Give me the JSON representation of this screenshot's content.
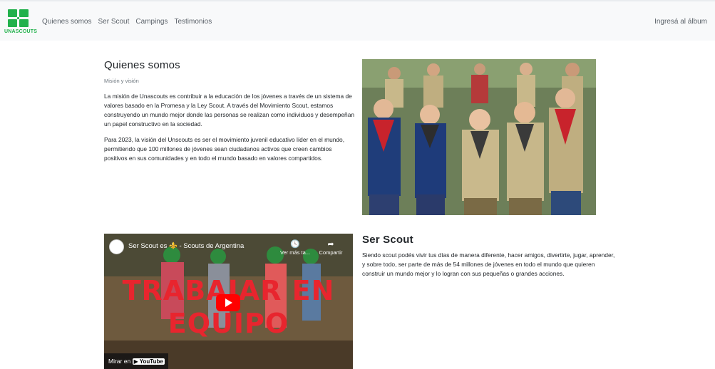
{
  "brand": {
    "name": "UNASCOUTS",
    "color": "#22b14c"
  },
  "nav": {
    "links": [
      "Quienes somos",
      "Ser Scout",
      "Campings",
      "Testimonios"
    ],
    "right_link": "Ingresá al álbum"
  },
  "about": {
    "title": "Quienes somos",
    "subtitle": "Misión y visión",
    "paragraphs": [
      "La misión de Unascouts es contribuir a la educación de los jóvenes a través de un sistema de valores basado en la Promesa y la Ley Scout. A través del Movimiento Scout, estamos construyendo un mundo mejor donde las personas se realizan como individuos y desempeñan un papel constructivo en la sociedad.",
      "Para 2023, la visión del Unscouts es ser el movimiento juvenil educativo líder en el mundo, permitiendo que 100 millones de jóvenes sean ciudadanos activos que creen cambios positivos en sus comunidades y en todo el mundo basado en valores compartidos."
    ]
  },
  "video": {
    "title": "Ser Scout es ⚜️ - Scouts de Argentina",
    "overlay_line1": "TRABAJAR EN",
    "overlay_line2": "EQUIPO",
    "watch_later": "Ver más ta...",
    "share": "Compartir",
    "watch_on": "Mirar en",
    "youtube": "▶ YouTube"
  },
  "ser_scout": {
    "title": "Ser Scout",
    "text": "Siendo scout podés vivir tus días de manera diferente, hacer amigos, divertirte, jugar, aprender, y sobre todo, ser parte de más de 54 millones de jóvenes en todo el mundo que quieren construir un mundo mejor y lo logran con sus pequeñas o grandes acciones."
  }
}
